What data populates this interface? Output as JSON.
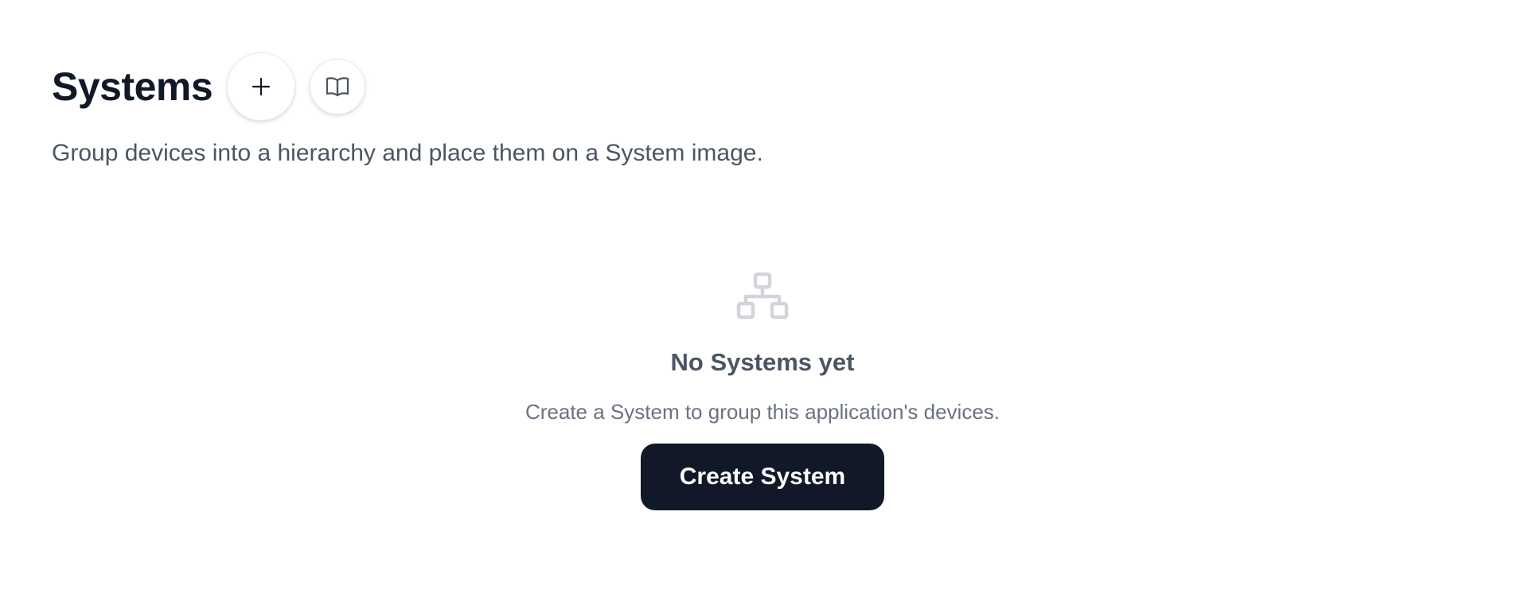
{
  "header": {
    "title": "Systems",
    "add_icon": "plus-icon",
    "docs_icon": "book-open-icon"
  },
  "subtitle": "Group devices into a hierarchy and place them on a System image.",
  "empty_state": {
    "icon": "hierarchy-icon",
    "title": "No Systems yet",
    "description": "Create a System to group this application's devices.",
    "button_label": "Create System"
  },
  "colors": {
    "primary": "#111827",
    "muted_text": "#4b5563",
    "secondary_text": "#6b7280",
    "icon_gray": "#d1d5db"
  }
}
